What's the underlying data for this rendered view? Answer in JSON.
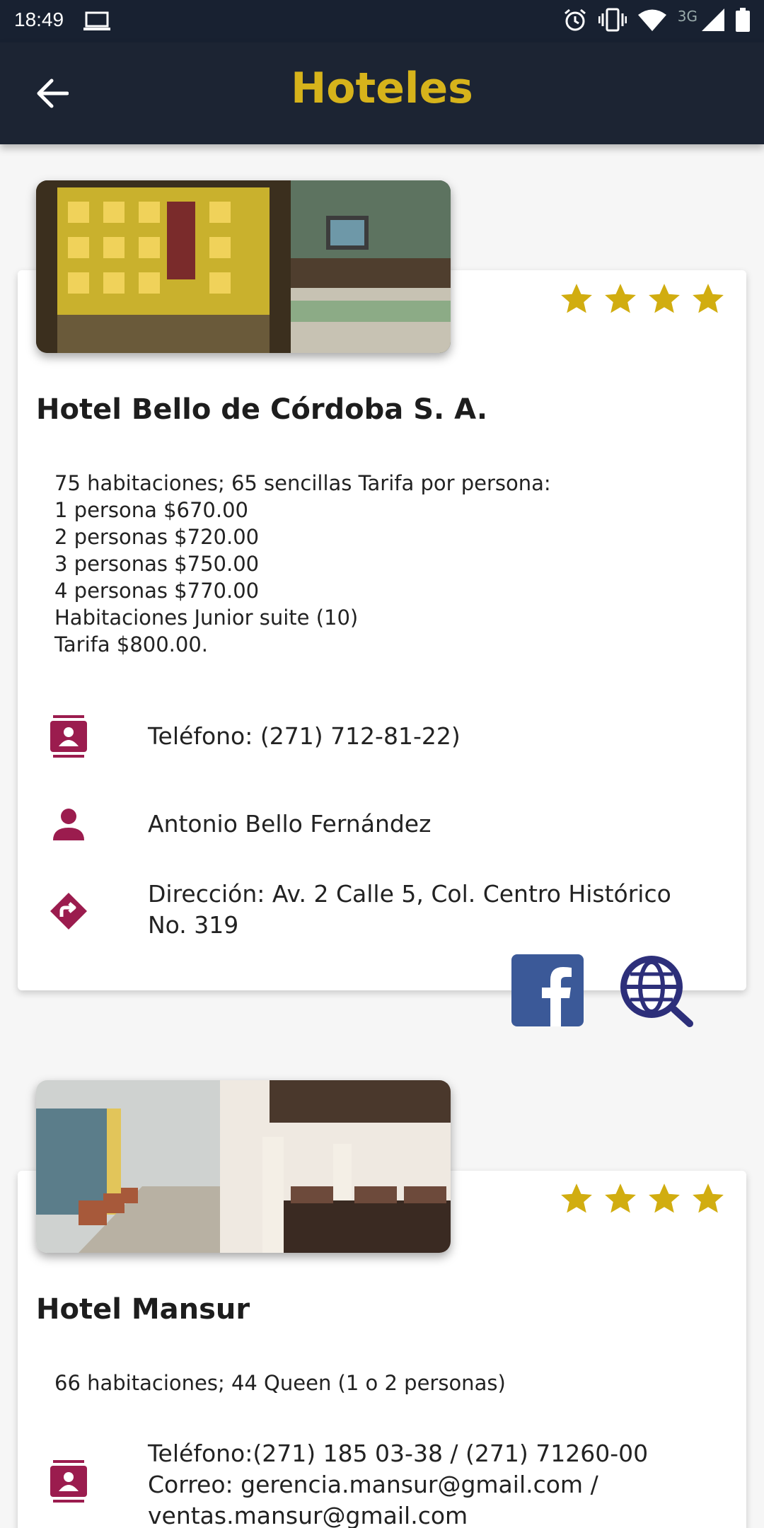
{
  "status_bar": {
    "time": "18:49",
    "network_label": "3G",
    "icons": [
      "laptop-icon",
      "alarm-icon",
      "vibrate-icon",
      "wifi-icon",
      "signal-icon",
      "battery-icon"
    ]
  },
  "app_bar": {
    "title": "Hoteles",
    "back_icon": "arrow-back-icon",
    "title_color": "#d6b31b",
    "background": "#1c2433"
  },
  "colors": {
    "star": "#d1ad10",
    "icon": "#9b1c4e",
    "facebook": "#3b5998",
    "web": "#2d2f7a"
  },
  "hotels": [
    {
      "name": "Hotel Bello de Córdoba S. A.",
      "stars": 4,
      "description": [
        "75 habitaciones; 65 sencillas Tarifa por persona:",
        "1 persona $670.00",
        "2 personas $720.00",
        "3 personas $750.00",
        "4 personas $770.00",
        "Habitaciones Junior suite (10)",
        "Tarifa $800.00."
      ],
      "phone": "Teléfono: (271) 712-81-22)",
      "contact": "Antonio Bello Fernández",
      "address_line1": "Dirección: Av. 2 Calle 5, Col. Centro Histórico",
      "address_line2": "No. 319",
      "links": [
        "facebook-icon",
        "web-search-icon"
      ]
    },
    {
      "name": "Hotel Mansur",
      "stars": 4,
      "description": [
        "66 habitaciones; 44 Queen (1 o 2 personas)"
      ],
      "phone_line1": "Teléfono:(271) 185 03-38 / (271) 71260-00",
      "phone_line2": "Correo: gerencia.mansur@gmail.com /",
      "phone_line3": "ventas.mansur@gmail.com"
    }
  ]
}
